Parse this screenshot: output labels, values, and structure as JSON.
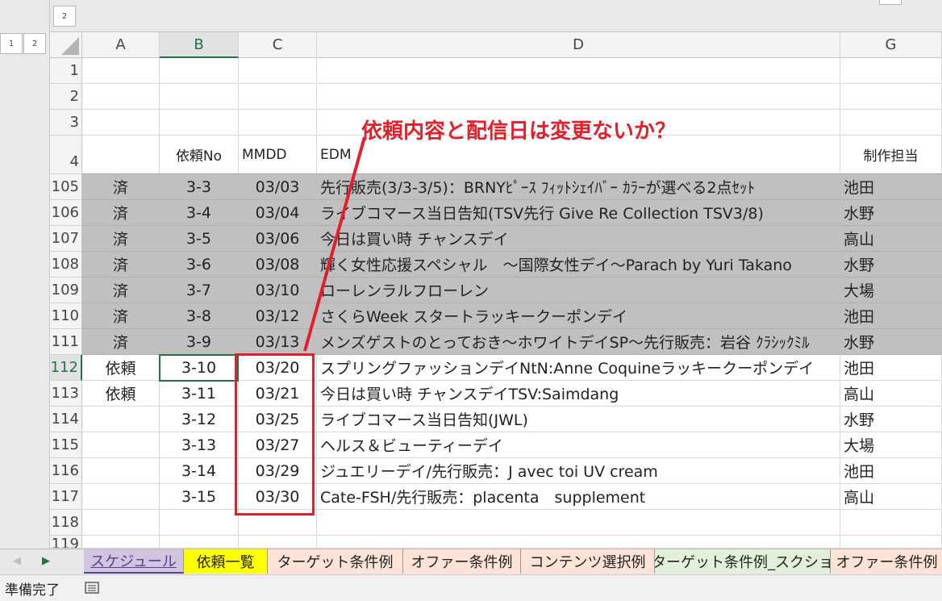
{
  "outline": {
    "level_top": "2",
    "level_left_1": "1",
    "level_left_2": "2"
  },
  "columns": [
    "A",
    "B",
    "C",
    "D",
    "G"
  ],
  "header_rows": [
    "1",
    "2",
    "3",
    "4"
  ],
  "headers": {
    "b": "依頼No",
    "c": "MMDD",
    "d": "EDM",
    "g": "制作担当"
  },
  "rows": [
    {
      "num": "105",
      "status": "済",
      "no": "3-3",
      "date": "03/03",
      "edm": "先行販売(3/3-3/5)：BRNYﾋﾟｰｽ ﾌｨｯﾄｼｪｲﾊﾞｰ ｶﾗｰが選べる2点ｾｯﾄ",
      "owner": "池田",
      "done": true
    },
    {
      "num": "106",
      "status": "済",
      "no": "3-4",
      "date": "03/04",
      "edm": "ライブコマース当日告知(TSV先行 Give Re Collection TSV3/8)",
      "owner": "水野",
      "done": true
    },
    {
      "num": "107",
      "status": "済",
      "no": "3-5",
      "date": "03/06",
      "edm": "今日は買い時 チャンスデイ",
      "owner": "高山",
      "done": true
    },
    {
      "num": "108",
      "status": "済",
      "no": "3-6",
      "date": "03/08",
      "edm": "輝く女性応援スペシャル　～国際女性デイ～Parach by Yuri Takano",
      "owner": "水野",
      "done": true
    },
    {
      "num": "109",
      "status": "済",
      "no": "3-7",
      "date": "03/10",
      "edm": "ローレンラルフローレン",
      "owner": "大場",
      "done": true
    },
    {
      "num": "110",
      "status": "済",
      "no": "3-8",
      "date": "03/12",
      "edm": "さくらWeek スタートラッキークーポンデイ",
      "owner": "池田",
      "done": true
    },
    {
      "num": "111",
      "status": "済",
      "no": "3-9",
      "date": "03/13",
      "edm": "メンズゲストのとっておき～ホワイトデイSP～先行販売：岩谷 ｸﾗｼｯｸﾐﾙ",
      "owner": "水野",
      "done": true
    },
    {
      "num": "112",
      "status": "依頼",
      "no": "3-10",
      "date": "03/20",
      "edm": "スプリングファッションデイNtN:Anne Coquineラッキークーポンデイ",
      "owner": "池田",
      "done": false
    },
    {
      "num": "113",
      "status": "依頼",
      "no": "3-11",
      "date": "03/21",
      "edm": "今日は買い時 チャンスデイTSV:Saimdang",
      "owner": "高山",
      "done": false
    },
    {
      "num": "114",
      "status": "",
      "no": "3-12",
      "date": "03/25",
      "edm": "ライブコマース当日告知(JWL)",
      "owner": "水野",
      "done": false
    },
    {
      "num": "115",
      "status": "",
      "no": "3-13",
      "date": "03/27",
      "edm": "ヘルス＆ビューティーデイ",
      "owner": "大場",
      "done": false
    },
    {
      "num": "116",
      "status": "",
      "no": "3-14",
      "date": "03/29",
      "edm": "ジュエリーデイ/先行販売：J avec toi UV cream",
      "owner": "池田",
      "done": false
    },
    {
      "num": "117",
      "status": "",
      "no": "3-15",
      "date": "03/30",
      "edm": "Cate-FSH/先行販売：placenta　supplement",
      "owner": "高山",
      "done": false
    }
  ],
  "extra_rows": [
    "118",
    "119"
  ],
  "annotation": {
    "text": "依頼内容と配信日は変更ないか？",
    "color": "#e0202a"
  },
  "tabs": [
    {
      "label": "スケジュール",
      "color": "#cfc5e0"
    },
    {
      "label": "依頼一覧",
      "color": "#ffff00"
    },
    {
      "label": "ターゲット条件例",
      "color": "#fbe3d6"
    },
    {
      "label": "オファー条件例",
      "color": "#fbe3d6"
    },
    {
      "label": "コンテンツ選択例",
      "color": "#fbe3d6"
    },
    {
      "label": "ターゲット条件例_スクショ",
      "color": "#e2efda"
    },
    {
      "label": "オファー条件例",
      "color": "#fbe3d6"
    }
  ],
  "status_bar": {
    "text": "準備完了"
  }
}
